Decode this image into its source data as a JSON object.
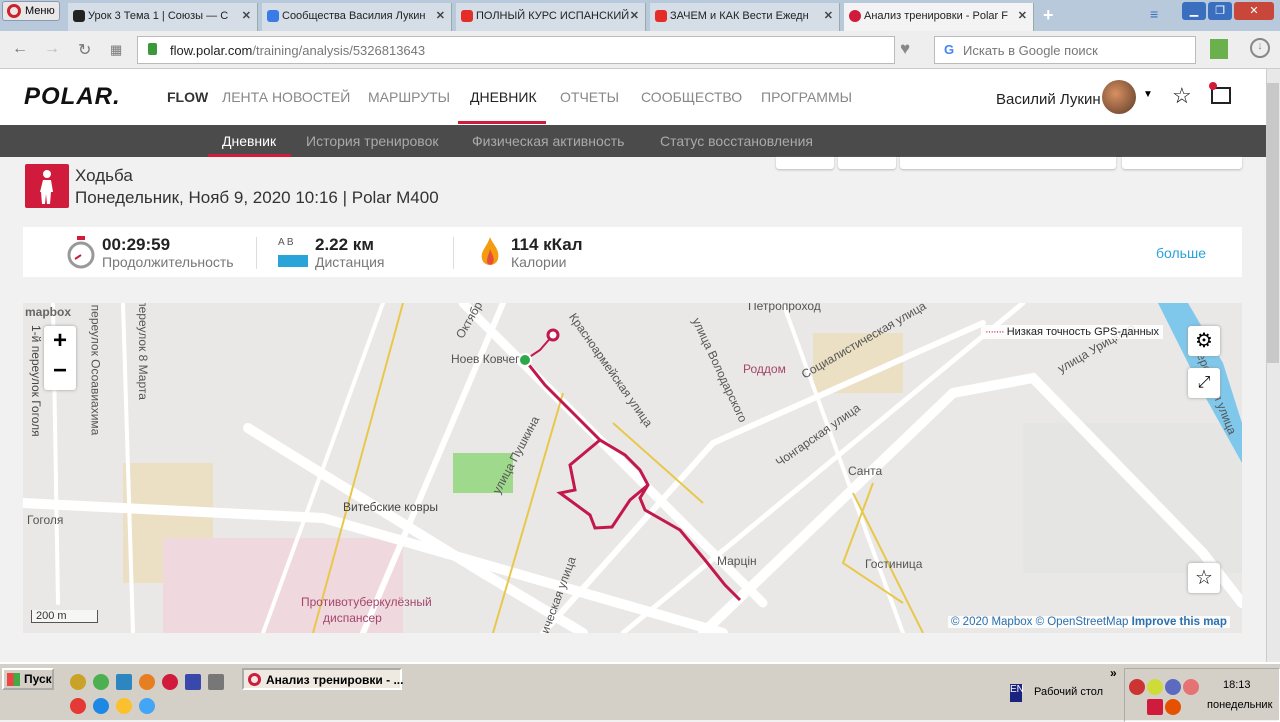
{
  "browser": {
    "menu_label": "Меню",
    "tabs": [
      {
        "label": "Урок 3 Тема 1 | Союзы — С",
        "icon": "book-icon",
        "color": "#222"
      },
      {
        "label": "Сообщества Василия Лукин",
        "icon": "play-icon",
        "color": "#3a7be8"
      },
      {
        "label": "ПОЛНЫЙ КУРС ИСПАНСКИЙ",
        "icon": "youtube-icon",
        "color": "#e52d27"
      },
      {
        "label": "ЗАЧЕМ и КАК Вести Ежедн",
        "icon": "youtube-icon",
        "color": "#e52d27"
      },
      {
        "label": "Анализ тренировки - Polar F",
        "icon": "polar-icon",
        "color": "#d11b3c"
      }
    ],
    "url_domain": "flow.polar.com",
    "url_path": "/training/analysis/5326813643",
    "search_placeholder": "Искать в Google поиск"
  },
  "header": {
    "logo": "POLAR.",
    "flow": "FLOW",
    "nav": [
      "ЛЕНТА НОВОСТЕЙ",
      "МАРШРУТЫ",
      "ДНЕВНИК",
      "ОТЧЕТЫ",
      "СООБЩЕСТВО",
      "ПРОГРАММЫ"
    ],
    "active_nav": 2,
    "user_name": "Василий Лукин"
  },
  "subnav": {
    "items": [
      "Дневник",
      "История тренировок",
      "Физическая активность",
      "Статус восстановления"
    ],
    "active": 0
  },
  "activity": {
    "sport": "Ходьба",
    "details": "Понедельник, Нояб 9, 2020 10:16 | Polar M400"
  },
  "stats": {
    "duration": {
      "value": "00:29:59",
      "label": "Продолжительность"
    },
    "distance": {
      "value": "2.22 км",
      "label": "Дистанция",
      "ab": "A  B"
    },
    "calories": {
      "value": "114 кКал",
      "label": "Калории"
    },
    "more": "больше"
  },
  "map": {
    "brand": "mapbox",
    "legend": "Низкая точность GPS-данных",
    "scale": "200 m",
    "attribution": {
      "copy": "© 2020 Mapbox",
      "osm": "© OpenStreetMap",
      "improve": "Improve this map"
    },
    "labels": {
      "noev": "Ноев Ковчег",
      "vitebsk": "Витебские ковры",
      "tb1": "Противотуберкулёзный",
      "tb2": "диспансер",
      "roddom": "Роддом",
      "santa": "Санта",
      "martsin": "Марцін",
      "hotel": "Гостиница",
      "petro": "Петропроход",
      "gogol1": "1-й переулок Гоголя",
      "osoav": "переулок Осоавиахима",
      "march8": "переулок 8 Марта",
      "gogol": "Гоголя",
      "oktyabr": "Октябр",
      "krasnoarm": "Красноармейская улица",
      "pushkin": "улица Пушкина",
      "volodar": "улица Володарского",
      "social": "Социалистическая улица",
      "chongar": "Чонгарская улица",
      "uritsk": "улица Урицкого",
      "beregov": "Береговая улица",
      "ichesk": "ическая улица"
    }
  },
  "taskbar": {
    "start": "Пуск",
    "window": "Анализ тренировки - ...",
    "lang": "EN",
    "desktop": "Рабочий стол",
    "time": "18:13",
    "day": "понедельник"
  }
}
